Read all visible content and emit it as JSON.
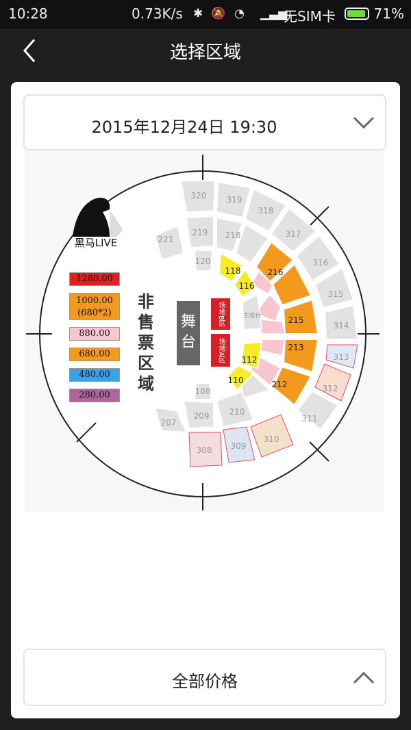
{
  "status_bar": {
    "time": "10:28",
    "network_speed": "0.73K/s",
    "sim": "无SIM卡",
    "battery": "71%",
    "battery_level": 0.71
  },
  "nav": {
    "title": "选择区域"
  },
  "date_selector": {
    "label": "2015年12月24日 19:30"
  },
  "map": {
    "brand": "黑马LIVE",
    "non_sale": [
      "非",
      "售",
      "票",
      "区",
      "域"
    ],
    "stage": [
      "舞",
      "台"
    ],
    "pitch_b": "场地B区",
    "pitch_a": "场地A区",
    "legend": [
      {
        "label": "1280.00",
        "color": "#e02020"
      },
      {
        "label": "1000.00",
        "label2": "(680*2)",
        "color": "#f39a1e"
      },
      {
        "label": "880.00",
        "color": "#f7c6cf"
      },
      {
        "label": "680.00",
        "color": "#f39a1e"
      },
      {
        "label": "480.00",
        "color": "#3aa0e8"
      },
      {
        "label": "280.00",
        "color": "#b0649c"
      }
    ],
    "sections": {
      "s320": "320",
      "s319": "319",
      "s318": "318",
      "s317": "317",
      "s316": "316",
      "s315": "315",
      "s314": "314",
      "s313": "313",
      "s312": "312",
      "s311": "311",
      "s310": "310",
      "s309": "309",
      "s308": "308",
      "s221": "221",
      "s219": "219",
      "s218": "218",
      "s216": "216",
      "s215": "215",
      "s213": "213",
      "s212": "212",
      "s210": "210",
      "s209": "209",
      "s207": "207",
      "s120": "120",
      "s118": "118",
      "s116": "116",
      "s114": "主席台",
      "s112": "112",
      "s110": "110",
      "s108": "108"
    }
  },
  "price_filter": {
    "label": "全部价格"
  }
}
